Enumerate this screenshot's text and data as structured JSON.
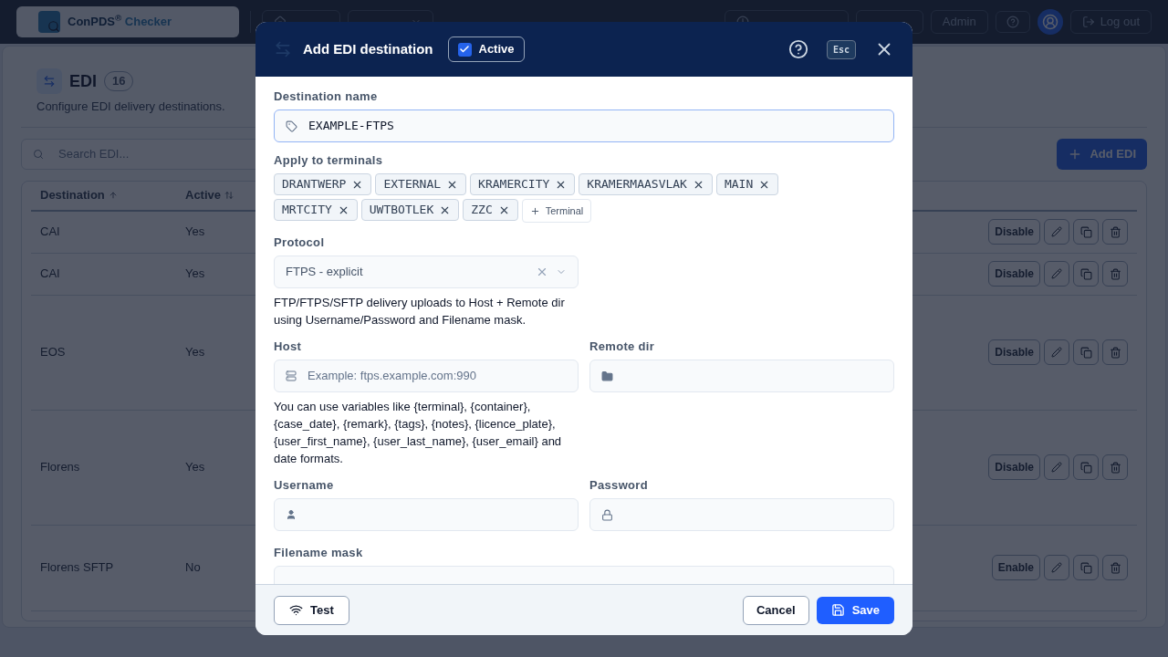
{
  "nav": {
    "brand": "ConPDS$^{®}$",
    "brand_suffix": "Checker",
    "left": [
      {
        "kind": "home"
      },
      {
        "kind": "dropdown"
      }
    ],
    "right": [
      {
        "kind": "clock"
      },
      {
        "kind": "blank"
      },
      {
        "kind": "plain",
        "label": "Admin"
      },
      {
        "kind": "help"
      },
      {
        "kind": "avatar"
      },
      {
        "kind": "logout",
        "label": "Log out"
      }
    ]
  },
  "page": {
    "title": "EDI",
    "count": "16",
    "subtitle": "Configure EDI delivery destinations.",
    "search_placeholder": "Search EDI...",
    "add_button": "Add EDI"
  },
  "table": {
    "columns": [
      {
        "label": "Destination",
        "kind": "sorted"
      },
      {
        "label": "Active",
        "kind": "sortable"
      }
    ],
    "rows": [
      {
        "destination": "CAI",
        "active": "Yes",
        "toggle": "Disable",
        "kind": "short"
      },
      {
        "destination": "CAI",
        "active": "Yes",
        "toggle": "Disable",
        "kind": "short"
      },
      {
        "destination": "EOS",
        "active": "Yes",
        "toggle": "Disable",
        "kind": "tall"
      },
      {
        "destination": "Florens",
        "active": "Yes",
        "toggle": "Disable",
        "kind": "tall"
      },
      {
        "destination": "Florens SFTP",
        "active": "No",
        "toggle": "Enable",
        "kind": "medium"
      }
    ]
  },
  "dialog": {
    "title": "Add EDI destination",
    "active": {
      "label": "Active",
      "checked": true
    },
    "esc": "Esc",
    "name_label": "Destination name",
    "name_value": "EXAMPLE-FTPS",
    "terminals_label": "Apply to terminals",
    "terminals": [
      "DRANTWERP",
      "EXTERNAL",
      "KRAMERCITY",
      "KRAMERMAASVLAK",
      "MAIN",
      "MRTCITY",
      "UWTBOTLEK",
      "ZZC"
    ],
    "add_terminal": "Terminal",
    "protocol_label": "Protocol",
    "protocol_value": "FTPS - explicit",
    "protocol_help": "FTP/FTPS/SFTP delivery uploads to Host + Remote dir using Username/Password and Filename mask.",
    "host_label": "Host",
    "host_placeholder": "Example: ftps.example.com:990",
    "remote_label": "Remote dir",
    "variables_help": "You can use variables like {terminal}, {container}, {case_date}, {remark}, {tags}, {notes}, {licence_plate}, {user_first_name}, {user_last_name}, {user_email} and date formats.",
    "username_label": "Username",
    "password_label": "Password",
    "mask_label": "Filename mask",
    "test_button": "Test",
    "cancel_button": "Cancel",
    "save_button": "Save"
  }
}
